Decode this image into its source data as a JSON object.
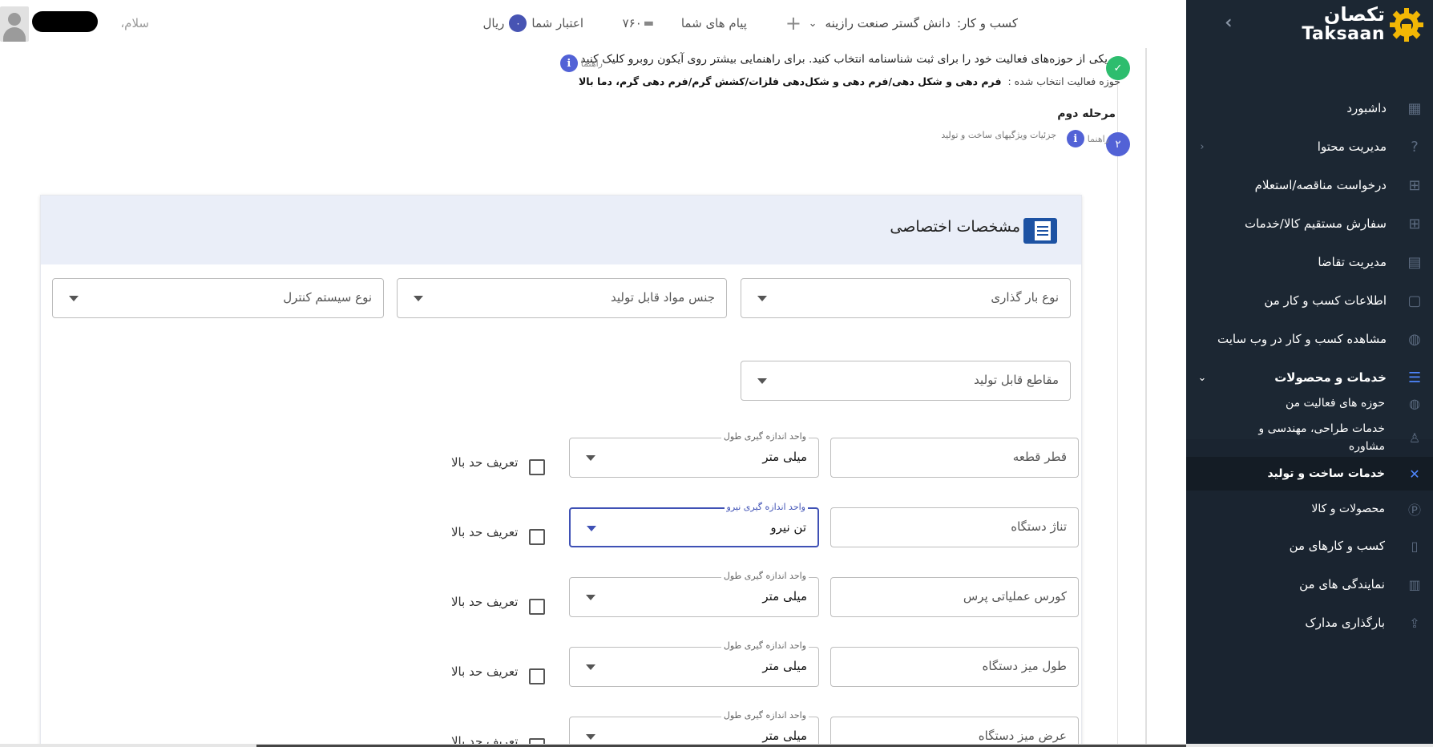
{
  "brand": {
    "fa": "تکصان",
    "en": "Taksaan"
  },
  "topbar": {
    "greeting": "سلام،",
    "business_label": "کسب و کار:",
    "business_name": "دانش گستر صنعت رازینه",
    "messages_label": "پیام های شما",
    "messages_count": "۷۶۰",
    "credit_label": "اعتبار شما",
    "credit_value": "۰",
    "credit_unit": "ریال"
  },
  "sidebar": {
    "items": [
      {
        "label": "داشبورد",
        "icon": "dashboard-icon"
      },
      {
        "label": "مدیریت محتوا",
        "icon": "help-circle-icon"
      },
      {
        "label": "درخواست مناقصه/استعلام",
        "icon": "plus-box-icon"
      },
      {
        "label": "سفارش مستقیم کالا/خدمات",
        "icon": "plus-box-icon"
      },
      {
        "label": "مدیریت تقاضا",
        "icon": "chart-icon"
      },
      {
        "label": "اطلاعات کسب و کار من",
        "icon": "document-icon"
      },
      {
        "label": "مشاهده کسب و کار در وب سایت",
        "icon": "globe-icon"
      },
      {
        "label": "خدمات و محصولات",
        "icon": "grid-list-icon"
      }
    ],
    "sub_items": [
      {
        "label": "حوزه های فعالیت من",
        "icon": "globe-icon"
      },
      {
        "label": "خدمات طراحی، مهندسی و مشاوره",
        "icon": "engineer-icon"
      },
      {
        "label": "خدمات ساخت و تولید",
        "icon": "tools-icon"
      },
      {
        "label": "محصولات و کالا",
        "icon": "product-icon"
      },
      {
        "label": "کسب و کارهای من",
        "icon": "building-icon"
      },
      {
        "label": "نمایندگی های من",
        "icon": "office-icon"
      },
      {
        "label": "بارگذاری مدارک",
        "icon": "upload-icon"
      }
    ]
  },
  "steps": {
    "step1": {
      "instruction": "یکی از حوزه‌های فعالیت خود را برای ثبت شناسنامه انتخاب کنید. برای راهنمایی بیشتر روی آیکون روبرو کلیک کنید",
      "guide": "راهنما",
      "selected_prefix": "حوزه فعالیت انتخاب شده :",
      "selected_value": "فرم دهی و شکل دهی/فرم دهی و شکل‌دهی فلزات/کشش گرم/فرم دهی گرم، دما بالا"
    },
    "step2": {
      "number": "۲",
      "title": "مرحله دوم",
      "guide": "راهنما",
      "subtitle": "جزئیات ویژگیهای ساخت و تولید"
    }
  },
  "card": {
    "title": "مشخصات اختصاصی",
    "selects_row1": [
      "نوع بار گذاری",
      "جنس مواد قابل تولید",
      "نوع سیستم کنترل"
    ],
    "select_row2": "مقاطع قابل تولید",
    "rows": [
      {
        "field": "قطر قطعه",
        "unit_label": "واحد اندازه گیری طول",
        "unit": "میلی متر",
        "check": "تعریف حد بالا",
        "focused": false
      },
      {
        "field": "تناژ دستگاه",
        "unit_label": "واحد اندازه گیری نیرو",
        "unit": "تن نیرو",
        "check": "تعریف حد بالا",
        "focused": true
      },
      {
        "field": "کورس عملیاتی پرس",
        "unit_label": "واحد اندازه گیری طول",
        "unit": "میلی متر",
        "check": "تعریف حد بالا",
        "focused": false
      },
      {
        "field": "طول میز دستگاه",
        "unit_label": "واحد اندازه گیری طول",
        "unit": "میلی متر",
        "check": "تعریف حد بالا",
        "focused": false
      },
      {
        "field": "عرض میز دستگاه",
        "unit_label": "واحد اندازه گیری طول",
        "unit": "میلی متر",
        "check": "تعریف حد بالا",
        "focused": false
      }
    ]
  },
  "colors": {
    "sidebar": "#1c2733",
    "accent": "#5262d6",
    "success": "#2dbd6e",
    "card_header": "#eaeef8"
  }
}
